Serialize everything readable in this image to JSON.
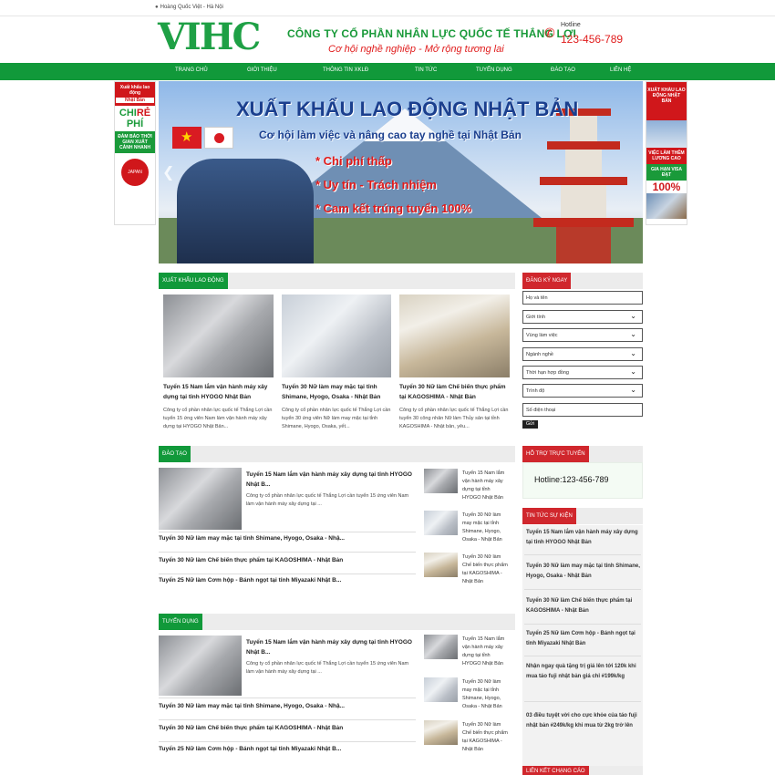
{
  "topbar": {
    "location": "Hoàng Quốc Việt - Hà Nội"
  },
  "header": {
    "logo": "VIHC",
    "company": "CÔNG TY CỔ PHẦN NHÂN LỰC QUỐC TẾ THẮNG LỢI",
    "slogan": "Cơ hội nghề nghiệp - Mở rộng tương lai",
    "hotline_label": "Hotline",
    "hotline_number": "123-456-789"
  },
  "nav": {
    "items": [
      {
        "label": "TRANG CHỦ"
      },
      {
        "label": "GIỚI THIỆU"
      },
      {
        "label": "THÔNG TIN XKLĐ"
      },
      {
        "label": "TIN TỨC"
      },
      {
        "label": "TUYỂN DỤNG"
      },
      {
        "label": "ĐÀO TẠO"
      },
      {
        "label": "LIÊN HỆ"
      }
    ]
  },
  "side_ads": {
    "left": {
      "top": "Xuất khẩu lao động",
      "top2": "Nhật Bản",
      "big1": "CHI",
      "big_red": "RẺ",
      "big2": "PHÍ",
      "body": "ĐẢM BẢO THỜI GIAN XUẤT CẢNH NHANH",
      "logo_text": "JAPAN"
    },
    "right": {
      "top": "XUẤT KHẨU LAO ĐỘNG NHẬT BẢN",
      "mid": "VIỆC LÀM THÊM LƯƠNG CAO",
      "green": "GIA HẠN VISA ĐẠT",
      "pct": "100%"
    }
  },
  "banner": {
    "title": "XUẤT KHẨU LAO ĐỘNG NHẬT BẢN",
    "subtitle": "Cơ hội làm việc và nâng cao tay nghề tại Nhật Bản",
    "bullets": [
      "* Chi phí thấp",
      "* Uy tín - Trách nhiệm",
      "* Cam kết trúng tuyển 100%"
    ]
  },
  "xkld": {
    "heading": "XUẤT KHẨU LAO ĐỘNG",
    "cards": [
      {
        "title": "Tuyển 15 Nam lắm vận hành máy xây dựng tại tỉnh HYOGO Nhật Bản",
        "desc": "Công ty cổ phần nhân lực quốc tế Thắng Lợi cần tuyển 15 ứng viên Nam làm vận hành máy xây dựng tại HYOGO Nhật Bản..."
      },
      {
        "title": "Tuyển 30 Nữ làm may mặc tại tỉnh Shimane, Hyogo, Osaka - Nhật Bản",
        "desc": "Công ty cổ phần nhân lực quốc tế Thắng Lợi cần tuyển 30 ứng viên Nữ làm may mặc tại tỉnh Shimane, Hyogo, Osaka, yết..."
      },
      {
        "title": "Tuyển 30 Nữ làm Chế biến thực phẩm tại KAGOSHIMA - Nhật Bản",
        "desc": "Công ty cổ phần nhân lực quốc tế Thắng Lợi cần tuyển 30 công nhân Nữ làm Thủy sản tại tỉnh KAGOSHIMA - Nhật bản, yêu..."
      }
    ]
  },
  "daotao": {
    "heading": "ĐÀO TẠO",
    "feature": {
      "title": "Tuyển 15 Nam lắm vận hành máy xây dựng tại tỉnh HYOGO Nhật B...",
      "desc": "Công ty cổ phần nhân lực quốc tế Thắng Lợi cần tuyển 15 ứng viên Nam làm vận hành máy xây dựng tại ..."
    },
    "list": [
      "Tuyển 30 Nữ làm may mặc tại tỉnh Shimane, Hyogo, Osaka - Nhậ...",
      "Tuyển 30 Nữ làm Chế biến thực phẩm tại KAGOSHIMA - Nhật Bản",
      "Tuyển 25 Nữ làm Cơm hộp - Bánh ngọt tại tỉnh Miyazaki Nhật B..."
    ],
    "mini": [
      "Tuyển 15 Nam lắm vận hành máy xây dựng tại tỉnh HYOGO Nhật Bản",
      "Tuyển 30 Nữ làm may mặc tại tỉnh Shimane, Hyogo, Osaka - Nhật Bản",
      "Tuyển 30 Nữ làm Chế biến thực phẩm tại KAGOSHIMA - Nhật Bản"
    ]
  },
  "tuyendung": {
    "heading": "TUYỂN DỤNG",
    "feature": {
      "title": "Tuyển 15 Nam lắm vận hành máy xây dựng tại tỉnh HYOGO Nhật B...",
      "desc": "Công ty cổ phần nhân lực quốc tế Thắng Lợi cần tuyển 15 ứng viên Nam làm vận hành máy xây dựng tại ..."
    },
    "list": [
      "Tuyển 30 Nữ làm may mặc tại tỉnh Shimane, Hyogo, Osaka - Nhậ...",
      "Tuyển 30 Nữ làm Chế biến thực phẩm tại KAGOSHIMA - Nhật Bản",
      "Tuyển 25 Nữ làm Cơm hộp - Bánh ngọt tại tỉnh Miyazaki Nhật B..."
    ],
    "mini": [
      "Tuyển 15 Nam lắm vận hành máy xây dựng tại tỉnh HYOGO Nhật Bản",
      "Tuyển 30 Nữ làm may mặc tại tỉnh Shimane, Hyogo, Osaka - Nhật Bản",
      "Tuyển 30 Nữ làm Chế biến thực phẩm tại KAGOSHIMA - Nhật Bản"
    ]
  },
  "register": {
    "heading": "ĐĂNG KÝ NGAY",
    "name_placeholder": "Họ và tên",
    "selects": [
      "Giới tính",
      "Vùng làm việc",
      "Ngành nghề",
      "Thời hạn hợp đồng",
      "Trình độ"
    ],
    "phone_placeholder": "Số điện thoại",
    "submit": "Gửi"
  },
  "support": {
    "heading": "HỖ TRỢ TRỰC TUYẾN",
    "hotline": "Hotline:123-456-789"
  },
  "events": {
    "heading": "TIN TỨC SỰ KIỆN",
    "items": [
      "Tuyển 15 Nam lắm vận hành máy xây dựng tại tỉnh HYOGO Nhật Bản",
      "Tuyển 30 Nữ làm may mặc tại tỉnh Shimane, Hyogo, Osaka - Nhật Bản",
      "Tuyển 30 Nữ làm Chế biến thực phẩm tại KAGOSHIMA - Nhật Bản",
      "Tuyển 25 Nữ làm Cơm hộp - Bánh ngọt tại tỉnh Miyazaki Nhật Bản",
      "Nhận ngay quà tặng trị giá lên tới 120k khi mua táo fuji nhật bản giá chỉ #199k/kg",
      "03 điều tuyệt vời cho cực khỏe của táo fuji nhật bản #249k/kg khi mua từ 2kg trở lên"
    ]
  },
  "links": {
    "heading": "LIÊN KẾT CHẠNG CÁO"
  }
}
